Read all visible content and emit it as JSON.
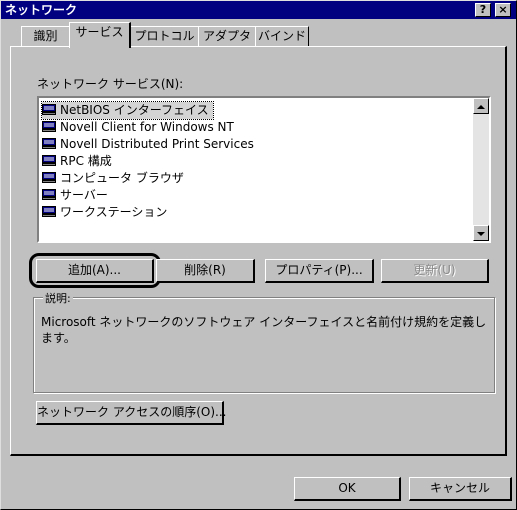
{
  "window": {
    "title": "ネットワーク"
  },
  "title_buttons": {
    "help": "?",
    "close": "×"
  },
  "tabs": [
    {
      "label": "識別"
    },
    {
      "label": "サービス",
      "active": true
    },
    {
      "label": "プロトコル"
    },
    {
      "label": "アダプタ"
    },
    {
      "label": "バインド"
    }
  ],
  "services_label": "ネットワーク サービス(N):",
  "services": [
    {
      "label": "NetBIOS インターフェイス",
      "selected": true
    },
    {
      "label": "Novell Client for Windows NT"
    },
    {
      "label": "Novell Distributed Print Services"
    },
    {
      "label": "RPC 構成"
    },
    {
      "label": "コンピュータ ブラウザ"
    },
    {
      "label": "サーバー"
    },
    {
      "label": "ワークステーション"
    }
  ],
  "buttons": {
    "add": "追加(A)...",
    "remove": "削除(R)",
    "properties": "プロパティ(P)...",
    "update": "更新(U)",
    "access_order": "ネットワーク アクセスの順序(O)...",
    "ok": "OK",
    "cancel": "キャンセル"
  },
  "description": {
    "title": "説明:",
    "text": "Microsoft ネットワークのソフトウェア インターフェイスと名前付け規約を定義します。"
  },
  "colors": {
    "titlebar": "#000080",
    "face": "#c0c0c0",
    "selection": "#d4d4d4"
  }
}
